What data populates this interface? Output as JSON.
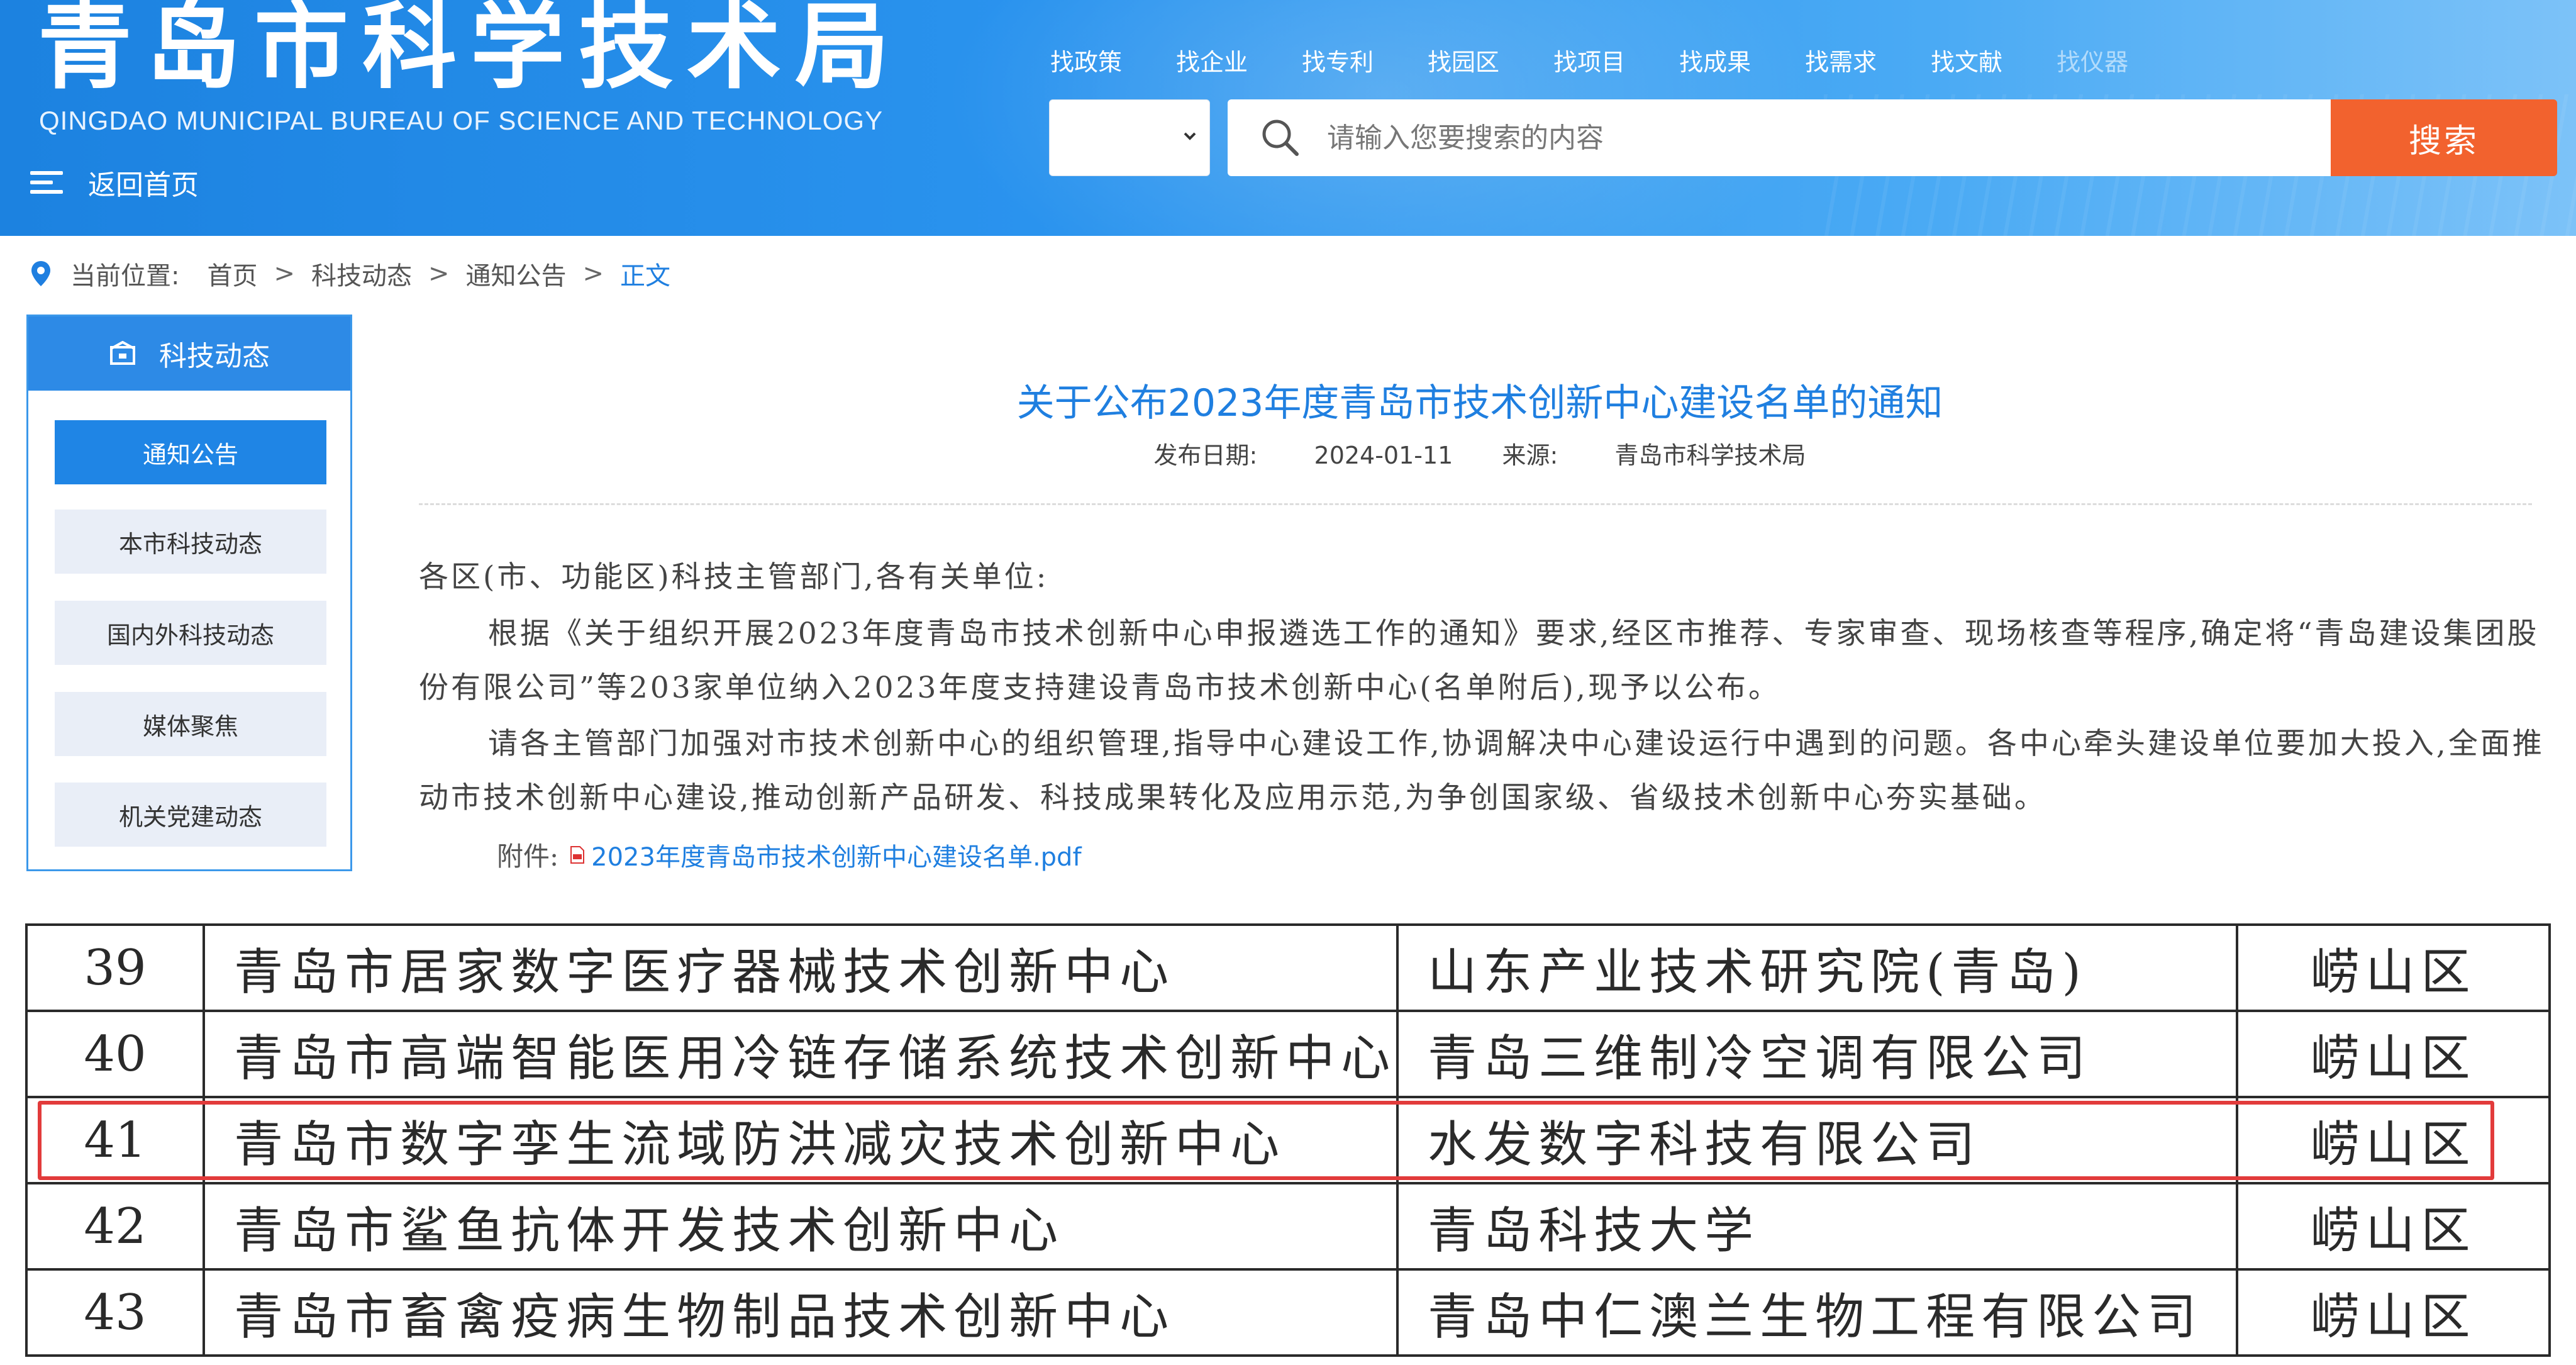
{
  "header": {
    "site_title": "青岛市科学技术局",
    "site_subtitle": "QINGDAO MUNICIPAL BUREAU OF SCIENCE AND TECHNOLOGY",
    "back_home": "返回首页",
    "nav_links": [
      "找政策",
      "找企业",
      "找专利",
      "找园区",
      "找项目",
      "找成果",
      "找需求",
      "找文献",
      "找仪器"
    ],
    "search_placeholder": "请输入您要搜索的内容",
    "search_button": "搜索"
  },
  "breadcrumb": {
    "label": "当前位置:",
    "items": [
      "首页",
      "科技动态",
      "通知公告",
      "正文"
    ],
    "separator": ">"
  },
  "sidebar": {
    "title": "科技动态",
    "items": [
      "通知公告",
      "本市科技动态",
      "国内外科技动态",
      "媒体聚焦",
      "机关党建动态"
    ],
    "active_index": 0
  },
  "article": {
    "title": "关于公布2023年度青岛市技术创新中心建设名单的通知",
    "date_label": "发布日期:",
    "date": "2024-01-11",
    "source_label": "来源:",
    "source": "青岛市科学技术局",
    "paragraphs": [
      "各区(市、功能区)科技主管部门,各有关单位:",
      "根据《关于组织开展2023年度青岛市技术创新中心申报遴选工作的通知》要求,经区市推荐、专家审查、现场核查等程序,确定将“青岛建设集团股份有限公司”等203家单位纳入2023年度支持建设青岛市技术创新中心(名单附后),现予以公布。",
      "请各主管部门加强对市技术创新中心的组织管理,指导中心建设工作,协调解决中心建设运行中遇到的问题。各中心牵头建设单位要加大投入,全面推动市技术创新中心建设,推动创新产品研发、科技成果转化及应用示范,为争创国家级、省级技术创新中心夯实基础。"
    ],
    "attachment_label": "附件:",
    "attachment_file": "2023年度青岛市技术创新中心建设名单.pdf"
  },
  "table": {
    "rows": [
      {
        "num": "39",
        "name": "青岛市居家数字医疗器械技术创新中心",
        "org": "山东产业技术研究院(青岛)",
        "district": "崂山区"
      },
      {
        "num": "40",
        "name": "青岛市高端智能医用冷链存储系统技术创新中心",
        "org": "青岛三维制冷空调有限公司",
        "district": "崂山区"
      },
      {
        "num": "41",
        "name": "青岛市数字孪生流域防洪减灾技术创新中心",
        "org": "水发数字科技有限公司",
        "district": "崂山区"
      },
      {
        "num": "42",
        "name": "青岛市鲨鱼抗体开发技术创新中心",
        "org": "青岛科技大学",
        "district": "崂山区"
      },
      {
        "num": "43",
        "name": "青岛市畜禽疫病生物制品技术创新中心",
        "org": "青岛中仁澳兰生物工程有限公司",
        "district": "崂山区"
      }
    ],
    "highlighted_num": "41"
  },
  "colors": {
    "header_blue": "#2a93ee",
    "accent_blue": "#1f7fe0",
    "search_orange": "#f2622e",
    "highlight_red": "#e23b3b"
  }
}
